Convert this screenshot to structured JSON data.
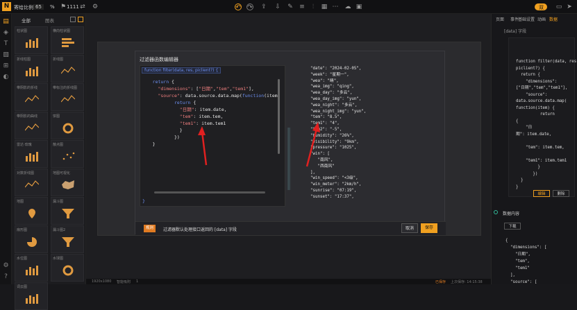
{
  "topbar": {
    "app_name": "寄给比例",
    "zoom": "65",
    "zoom_unit": "%",
    "count": "1111",
    "toggle_label": "双"
  },
  "components": {
    "tab_all": "全部",
    "tab_chart": "图表",
    "cards": [
      "柱状图",
      "横向柱状图",
      "折线柱图",
      "折线图",
      "带阴影的折线",
      "带标注的折线图",
      "带阴影的曲线",
      "饼图",
      "雷达·玫瑰",
      "散点图",
      "对数折线图",
      "地图可视化",
      "地图",
      "漏斗图",
      "扇形图",
      "漏斗图2",
      "水位图",
      "水球图",
      "词云图"
    ]
  },
  "dialog": {
    "title": "过滤器函数编辑器",
    "signature": "function filter(data, res, piclient?) {",
    "code_lines": [
      {
        "indent": "    ",
        "parts": [
          [
            "kw",
            "return"
          ],
          [
            "tx",
            " {"
          ]
        ]
      },
      {
        "indent": "      ",
        "parts": [
          [
            "str",
            "\"dimensions\""
          ],
          [
            "tx",
            ": ["
          ],
          [
            "str",
            "\"日期\""
          ],
          [
            "tx",
            ","
          ],
          [
            "str",
            "\"tem\""
          ],
          [
            "tx",
            ","
          ],
          [
            "str",
            "\"tem1\""
          ],
          [
            "tx",
            "],"
          ]
        ]
      },
      {
        "indent": "      ",
        "parts": [
          [
            "str",
            "\"source\""
          ],
          [
            "tx",
            ": data.source.data.map("
          ],
          [
            "kw",
            "function"
          ],
          [
            "tx",
            "(item)"
          ]
        ]
      },
      {
        "indent": "            ",
        "parts": [
          [
            "kw",
            "return"
          ],
          [
            "tx",
            " {"
          ]
        ]
      },
      {
        "indent": "              ",
        "parts": [
          [
            "str",
            "\"日期\""
          ],
          [
            "tx",
            ": item.date,"
          ]
        ]
      },
      {
        "indent": "              ",
        "parts": [
          [
            "str",
            "\"tem\""
          ],
          [
            "tx",
            ": item.tem,"
          ]
        ]
      },
      {
        "indent": "              ",
        "parts": [
          [
            "str",
            "\"tem1\""
          ],
          [
            "tx",
            ": item.tem1"
          ]
        ]
      },
      {
        "indent": "              ",
        "parts": [
          [
            "tx",
            "}"
          ]
        ]
      },
      {
        "indent": "            ",
        "parts": [
          [
            "tx",
            "})"
          ]
        ]
      },
      {
        "indent": "    ",
        "parts": [
          [
            "tx",
            "}"
          ]
        ]
      }
    ],
    "closing_brace": "}",
    "preview_lines": [
      "\"date\": \"2024-02-05\",",
      "\"week\": \"星期一\",",
      "\"wea\": \"晴\",",
      "\"wea_img\": \"qing\",",
      "\"wea_day\": \"多云\",",
      "\"wea_day_img\": \"yun\",",
      "\"wea_night\": \"多云\",",
      "\"wea_night_img\": \"yun\",",
      "\"tem\": \"8.5\",",
      "\"tem1\": \"4\",",
      "\"tem2\": \"-5\",",
      "\"humidity\": \"26%\",",
      "\"visibility\": \"9km\",",
      "\"pressure\": \"1025\",",
      "\"win\": [",
      "   \"南风\",",
      "   \"西南风\"",
      "],",
      "\"win_speed\": \"<3级\",",
      "\"win_meter\": \"2km/h\",",
      "\"sunrise\": \"07:19\",",
      "\"sunset\": \"17:37\","
    ],
    "footer_tag": "规则",
    "footer_text": "过滤器默认处理接口返回的 [data] 字段",
    "cancel": "取消",
    "save": "保存"
  },
  "right": {
    "tabs": [
      "页面",
      "事件",
      "基础设置",
      "动画",
      "数据"
    ],
    "field_note": "[data] 字段",
    "code_lines": [
      "function filter(data, res,",
      "piclient?) {",
      "  return {",
      "    \"dimensions\":",
      "[\"日期\",\"tem\",\"tem1\"],",
      "    \"source\":",
      "data.source.data.map(",
      "function(item) {",
      "          return",
      "{",
      "    \"日",
      "期\": item.date,",
      "",
      "    \"tem\": item.tem,",
      "",
      "    \"tem1\": item.tem1",
      "         }",
      "       })",
      "  }",
      "}"
    ],
    "edit": "编辑",
    "delete": "删除",
    "data_section": "数据内容",
    "download": "下载",
    "data_lines": [
      "{",
      "  \"dimensions\": [",
      "    \"日期\",",
      "    \"tem\",",
      "    \"tem1\"",
      "  ],",
      "  \"source\": ["
    ]
  },
  "status": {
    "resolution": "1920x1080",
    "snap": "智能吸附",
    "zoom": "1",
    "saved": "已保存",
    "time": "上次保存: 14:15:38"
  }
}
